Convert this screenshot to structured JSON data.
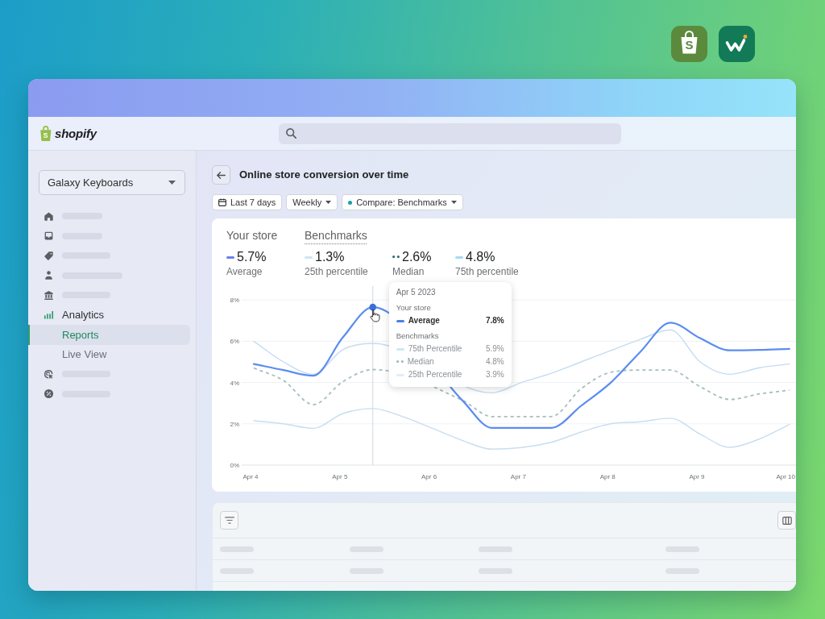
{
  "app_badges": [
    {
      "kind": "bag",
      "mark": "S"
    },
    {
      "kind": "wave"
    }
  ],
  "header": {
    "logo_mark": "S",
    "logo_text": "shopify"
  },
  "sidebar": {
    "store_selector": "Galaxy Keyboards",
    "items": [
      {
        "kind": "placeholder",
        "expanded": false
      },
      {
        "kind": "placeholder",
        "expanded": false
      },
      {
        "kind": "placeholder",
        "expanded": false
      },
      {
        "kind": "placeholder",
        "expanded": false
      },
      {
        "kind": "placeholder",
        "expanded": false
      },
      {
        "kind": "link",
        "label": "Analytics",
        "expanded": true,
        "children": [
          {
            "label": "Reports",
            "selected": true
          },
          {
            "label": "Live View",
            "selected": false
          }
        ]
      },
      {
        "kind": "placeholder",
        "expanded": false
      },
      {
        "kind": "placeholder",
        "expanded": false
      }
    ]
  },
  "report": {
    "title": "Online store conversion over time",
    "filters": [
      {
        "kind": "date",
        "label": "Last 7 days"
      },
      {
        "kind": "select",
        "label": "Weekly"
      },
      {
        "kind": "compare",
        "label": "Compare: Benchmarks",
        "color": "#17a2a6"
      }
    ],
    "metric_groups": [
      {
        "heading": "Your store",
        "kind": "plain",
        "metrics": [
          {
            "value": "5.7%",
            "kind": "solid",
            "color": "#6a80ee"
          }
        ]
      },
      {
        "heading": "Benchmarks",
        "kind": "dotted-underline",
        "metrics": [
          {
            "value": "1.3%",
            "kind": "solid",
            "color": "#cde6f5"
          },
          {
            "value": "2.6%",
            "kind": "dotted",
            "color": "#2c6e6c"
          },
          {
            "value": "4.8%",
            "kind": "solid",
            "color": "#a6dbf1"
          }
        ]
      }
    ],
    "chart_data": {
      "type": "line",
      "grid": true,
      "categories": [
        "Apr 4",
        null,
        null,
        "Apr 5",
        null,
        null,
        "Apr 6",
        null,
        null,
        "Apr 7",
        null,
        null,
        "Apr 8",
        null,
        null,
        "Apr 9",
        null,
        null,
        "Apr 10"
      ],
      "ylim": [
        0,
        8
      ],
      "yticks": [
        {
          "value": 0,
          "label": "0%"
        },
        {
          "value": 2,
          "label": "2%"
        },
        {
          "value": 4,
          "label": "4%"
        },
        {
          "value": 6,
          "label": "6%"
        },
        {
          "value": 8,
          "label": "8%"
        }
      ],
      "series": [
        {
          "name": "Average",
          "color": "#5b8df0",
          "line_style": "solid",
          "values": [
            4.9,
            4.6,
            4.33,
            6.2,
            7.65,
            null,
            null,
            3.15,
            1.8,
            1.8,
            1.8,
            2.87,
            4.0,
            5.5,
            6.9,
            6.15,
            5.56,
            5.58,
            5.63
          ]
        },
        {
          "name": "25th percentile",
          "color": "#c9def0",
          "line_style": "solid",
          "values": [
            2.15,
            2.0,
            1.78,
            2.5,
            2.74,
            2.35,
            1.78,
            1.2,
            0.77,
            0.85,
            1.1,
            1.6,
            2.0,
            2.1,
            2.27,
            1.5,
            0.86,
            1.27,
            1.97
          ]
        },
        {
          "name": "Median",
          "color": "#a4bec0",
          "line_style": "dashed",
          "values": [
            4.7,
            4.1,
            2.93,
            4.05,
            4.63,
            null,
            null,
            3.15,
            2.35,
            2.35,
            2.35,
            3.7,
            4.5,
            4.6,
            4.6,
            3.8,
            3.18,
            3.45,
            3.63
          ]
        },
        {
          "name": "75th percentile",
          "color": "#c5dcf0",
          "line_style": "solid",
          "values": [
            6.0,
            5.0,
            4.4,
            5.6,
            5.9,
            null,
            null,
            null,
            3.5,
            4.0,
            4.45,
            5.0,
            5.55,
            6.1,
            6.55,
            5.0,
            4.4,
            4.72,
            4.9
          ]
        }
      ]
    },
    "tooltip": {
      "title": "Apr 5 2023",
      "sections": [
        {
          "heading": "Your store",
          "kind": "store",
          "rows": [
            {
              "label": "Average",
              "value": "7.8%",
              "kind": "solid",
              "color": "#4a80e8"
            }
          ]
        },
        {
          "heading": "Benchmarks",
          "kind": "benchmark",
          "rows": [
            {
              "label": "75th Percentile",
              "value": "5.9%",
              "kind": "solid",
              "color": "#cfe7f5"
            },
            {
              "label": "Median",
              "value": "4.8%",
              "kind": "dotted",
              "color": "#9dbcbd"
            },
            {
              "label": "25th Percentile",
              "value": "3.9%",
              "kind": "solid",
              "color": "#e3edf7"
            }
          ]
        }
      ]
    }
  }
}
